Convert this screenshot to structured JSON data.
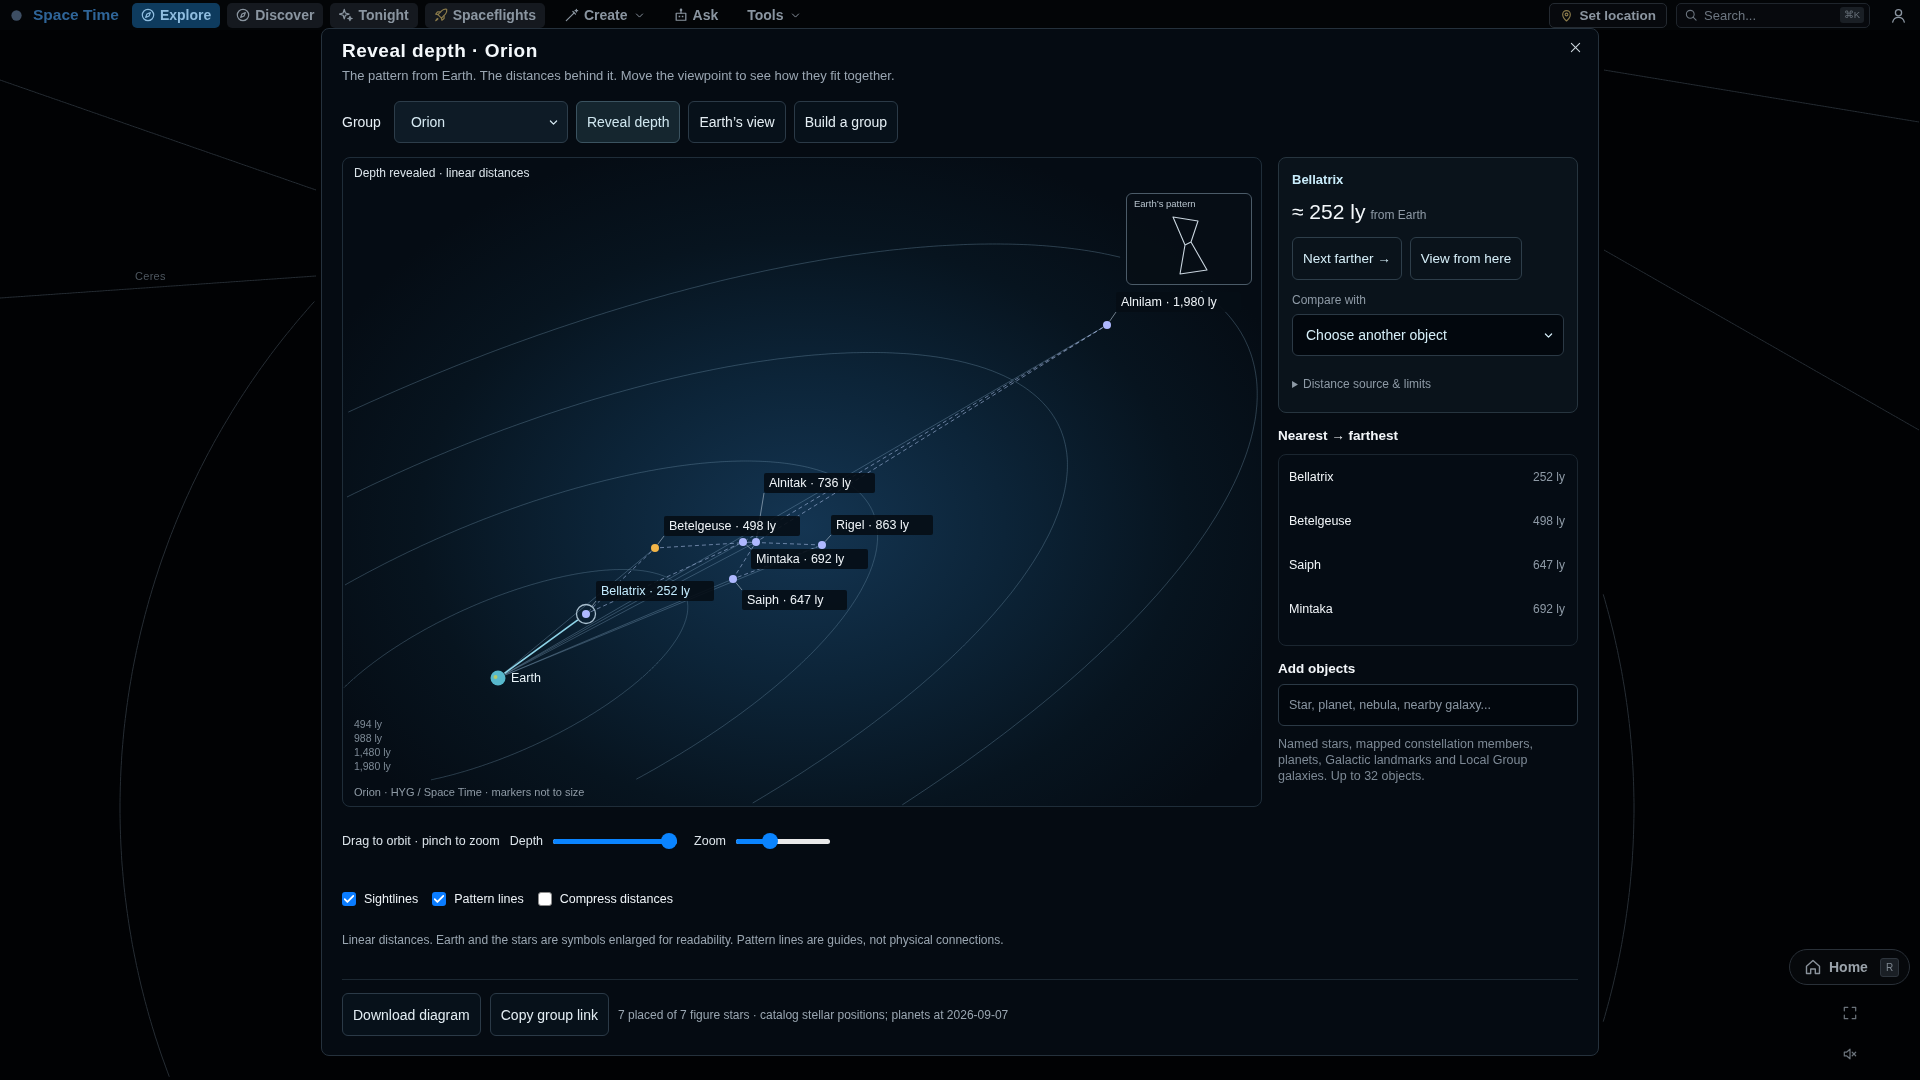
{
  "top_bar": {
    "logo": "Space Time",
    "nav": [
      {
        "label": "Explore",
        "kind": "tab",
        "selected": true,
        "dropdown": false
      },
      {
        "label": "Discover",
        "kind": "tab",
        "selected": false,
        "dropdown": false
      },
      {
        "label": "Tonight",
        "kind": "tab",
        "selected": false,
        "dropdown": false
      },
      {
        "label": "Spaceflights",
        "kind": "tab",
        "selected": false,
        "dropdown": false
      },
      {
        "label": "Create",
        "kind": "plain",
        "selected": false,
        "dropdown": true
      },
      {
        "label": "Ask",
        "kind": "plain",
        "selected": false,
        "dropdown": false
      },
      {
        "label": "Tools",
        "kind": "plain",
        "selected": false,
        "dropdown": true
      }
    ],
    "location_button": "Set location",
    "search": {
      "placeholder": "Search...",
      "shortcut": "⌘K"
    }
  },
  "backdrop": {
    "body_label": "Ceres"
  },
  "dialog": {
    "title": "Reveal depth · Orion",
    "subtitle": "The pattern from Earth. The distances behind it. Move the viewpoint to see how they fit together.",
    "group": {
      "label": "Group",
      "value": "Orion"
    },
    "modes": [
      {
        "label": "Reveal depth",
        "selected": true
      },
      {
        "label": "Earth’s view",
        "selected": false
      },
      {
        "label": "Build a group",
        "selected": false
      }
    ],
    "diagram": {
      "caption": "Depth revealed · linear distances",
      "inset_title": "Earth’s pattern",
      "origin": "Earth",
      "stars": [
        {
          "label": "Alnilam · 1,980 ly",
          "color": "#aeb8ff",
          "selected": false
        },
        {
          "label": "Alnitak · 736 ly",
          "color": "#aeb8ff",
          "selected": false
        },
        {
          "label": "Betelgeuse · 498 ly",
          "color": "#f2b548",
          "selected": false
        },
        {
          "label": "Rigel · 863 ly",
          "color": "#aeb8ff",
          "selected": false
        },
        {
          "label": "Mintaka · 692 ly",
          "color": "#aeb8ff",
          "selected": false
        },
        {
          "label": "Saiph · 647 ly",
          "color": "#aeb8ff",
          "selected": false
        },
        {
          "label": "Bellatrix · 252 ly",
          "color": "#aeb8ff",
          "selected": true
        }
      ],
      "scale": [
        "494 ly",
        "988 ly",
        "1,480 ly",
        "1,980 ly"
      ],
      "credit": "Orion · HYG / Space Time · markers not to size"
    },
    "controls": {
      "hint": "Drag to orbit · pinch to zoom",
      "sliders": [
        {
          "label": "Depth",
          "level": 1
        },
        {
          "label": "Zoom",
          "level": 0.33
        }
      ],
      "toggles": [
        {
          "label": "Sightlines",
          "checked": true
        },
        {
          "label": "Pattern lines",
          "checked": true
        },
        {
          "label": "Compress distances",
          "checked": false
        }
      ]
    },
    "note": "Linear distances. Earth and the stars are symbols enlarged for readability. Pattern lines are guides, not physical connections.",
    "details": {
      "name": "Bellatrix",
      "distance": "≈ 252 ly",
      "distance_note": "from Earth",
      "actions": [
        "Next farther →",
        "View from here"
      ],
      "compare_label": "Compare with",
      "compare_value": "Choose another object",
      "disclosure": {
        "label": "Distance source & limits",
        "expanded": false
      }
    },
    "ranking": {
      "title": "Nearest → farthest",
      "rows": [
        {
          "name": "Bellatrix",
          "distance": "252 ly"
        },
        {
          "name": "Betelgeuse",
          "distance": "498 ly"
        },
        {
          "name": "Saiph",
          "distance": "647 ly"
        },
        {
          "name": "Mintaka",
          "distance": "692 ly"
        }
      ]
    },
    "add_objects": {
      "title": "Add objects",
      "placeholder": "Star, planet, nebula, nearby galaxy...",
      "help": "Named stars, mapped constellation members, planets, Galactic landmarks and Local Group galaxies. Up to 32 objects."
    },
    "actions": [
      "Download diagram",
      "Copy group link"
    ],
    "status": "7 placed of 7 figure stars · catalog stellar positions; planets at 2026-09-07"
  },
  "corner": {
    "home": "Home",
    "home_shortcut": "R"
  }
}
